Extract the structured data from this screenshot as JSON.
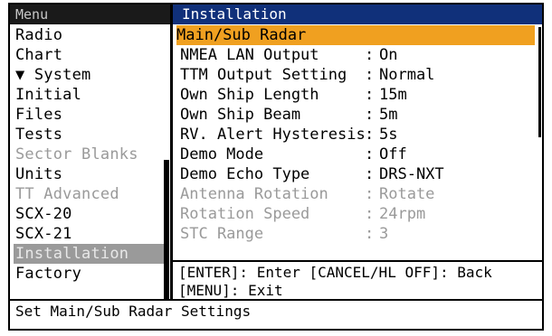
{
  "menu": {
    "title": "Menu",
    "items": [
      {
        "label": "Radio",
        "state": "normal"
      },
      {
        "label": "Chart",
        "state": "normal"
      },
      {
        "label": "▼ System",
        "state": "normal"
      },
      {
        "label": "Initial",
        "state": "normal"
      },
      {
        "label": "Files",
        "state": "normal"
      },
      {
        "label": "Tests",
        "state": "normal"
      },
      {
        "label": "Sector Blanks",
        "state": "disabled"
      },
      {
        "label": "Units",
        "state": "normal"
      },
      {
        "label": "TT Advanced",
        "state": "disabled"
      },
      {
        "label": "SCX-20",
        "state": "normal"
      },
      {
        "label": "SCX-21",
        "state": "normal"
      },
      {
        "label": "Installation",
        "state": "selected"
      },
      {
        "label": "Factory",
        "state": "normal"
      }
    ]
  },
  "panel": {
    "title": "Installation",
    "rows": [
      {
        "label": "Main/Sub Radar",
        "sep": "",
        "value": "",
        "state": "highlight"
      },
      {
        "label": "NMEA LAN Output",
        "sep": ":",
        "value": "On",
        "state": "normal"
      },
      {
        "label": "TTM Output Setting",
        "sep": ":",
        "value": "Normal",
        "state": "normal"
      },
      {
        "label": "Own Ship Length",
        "sep": ":",
        "value": "15m",
        "state": "normal"
      },
      {
        "label": "Own Ship Beam",
        "sep": ":",
        "value": "5m",
        "state": "normal"
      },
      {
        "label": "RV. Alert Hysteresis",
        "sep": ":",
        "value": "5s",
        "state": "normal"
      },
      {
        "label": "Demo Mode",
        "sep": ":",
        "value": "Off",
        "state": "normal"
      },
      {
        "label": "Demo Echo Type",
        "sep": ":",
        "value": "DRS-NXT",
        "state": "normal"
      },
      {
        "label": "Antenna Rotation",
        "sep": ":",
        "value": "Rotate",
        "state": "disabled"
      },
      {
        "label": "Rotation Speed",
        "sep": ":",
        "value": "24rpm",
        "state": "disabled"
      },
      {
        "label": "STC Range",
        "sep": ":",
        "value": "3",
        "state": "disabled"
      }
    ],
    "help": {
      "line1": "[ENTER]: Enter [CANCEL/HL OFF]: Back",
      "line2": "[MENU]: Exit"
    }
  },
  "status": {
    "text": "Set Main/Sub Radar Settings"
  }
}
